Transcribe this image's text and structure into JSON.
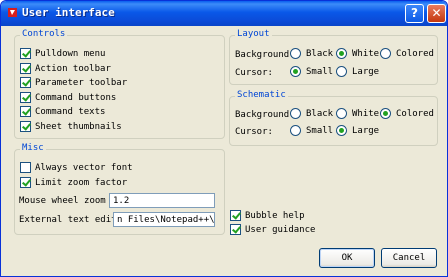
{
  "window": {
    "title": "User interface",
    "help_glyph": "?",
    "close_glyph": "✕",
    "accent": "#0a5fef"
  },
  "controls": {
    "title": "Controls",
    "items": [
      {
        "label": "Pulldown menu",
        "checked": true
      },
      {
        "label": "Action toolbar",
        "checked": true
      },
      {
        "label": "Parameter toolbar",
        "checked": true
      },
      {
        "label": "Command buttons",
        "checked": true
      },
      {
        "label": "Command texts",
        "checked": true
      },
      {
        "label": "Sheet thumbnails",
        "checked": true
      }
    ]
  },
  "misc": {
    "title": "Misc",
    "always_vector_font": {
      "label": "Always vector font",
      "checked": false
    },
    "limit_zoom_factor": {
      "label": "Limit zoom factor",
      "checked": true
    },
    "mouse_wheel_zoom": {
      "label": "Mouse wheel zoom",
      "value": "1.2"
    },
    "external_text_editor": {
      "label": "External text editor",
      "value": "n Files\\Notepad++\\notep"
    }
  },
  "layout": {
    "title": "Layout",
    "background": {
      "label": "Background:",
      "options": [
        "Black",
        "White",
        "Colored"
      ],
      "selected": "White"
    },
    "cursor": {
      "label": "Cursor:",
      "options": [
        "Small",
        "Large"
      ],
      "selected": "Small"
    }
  },
  "schematic": {
    "title": "Schematic",
    "background": {
      "label": "Background:",
      "options": [
        "Black",
        "White",
        "Colored"
      ],
      "selected": "Colored"
    },
    "cursor": {
      "label": "Cursor:",
      "options": [
        "Small",
        "Large"
      ],
      "selected": "Large"
    }
  },
  "bubble_help": {
    "label": "Bubble help",
    "checked": true
  },
  "user_guidance": {
    "label": "User guidance",
    "checked": true
  },
  "buttons": {
    "ok": "OK",
    "cancel": "Cancel"
  }
}
